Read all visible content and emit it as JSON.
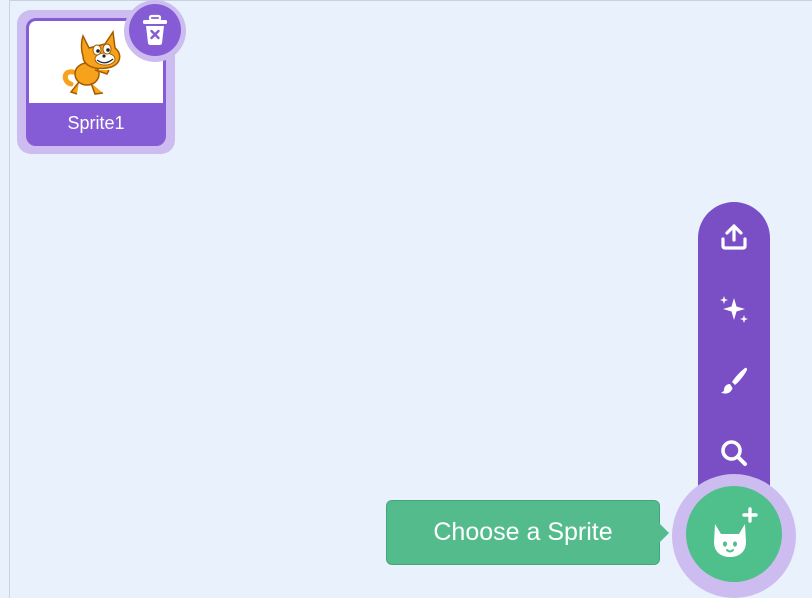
{
  "sprite_list": {
    "items": [
      {
        "name": "Sprite1",
        "selected": true,
        "thumbnail_icon": "scratch-cat-icon"
      }
    ],
    "delete_icon": "trash-icon"
  },
  "sprite_actions": {
    "menu": [
      {
        "icon": "upload-icon",
        "tooltip": ""
      },
      {
        "icon": "surprise-sparkles-icon",
        "tooltip": ""
      },
      {
        "icon": "paint-brush-icon",
        "tooltip": ""
      },
      {
        "icon": "search-icon",
        "tooltip": ""
      }
    ],
    "main_button_icon": "cat-add-icon",
    "tooltip_text": "Choose a Sprite"
  },
  "colors": {
    "background": "#e9f1fc",
    "accent_purple": "#855cd6",
    "menu_purple": "#7a4fc6",
    "halo": "#cdbcf0",
    "green": "#4fbf8c"
  }
}
